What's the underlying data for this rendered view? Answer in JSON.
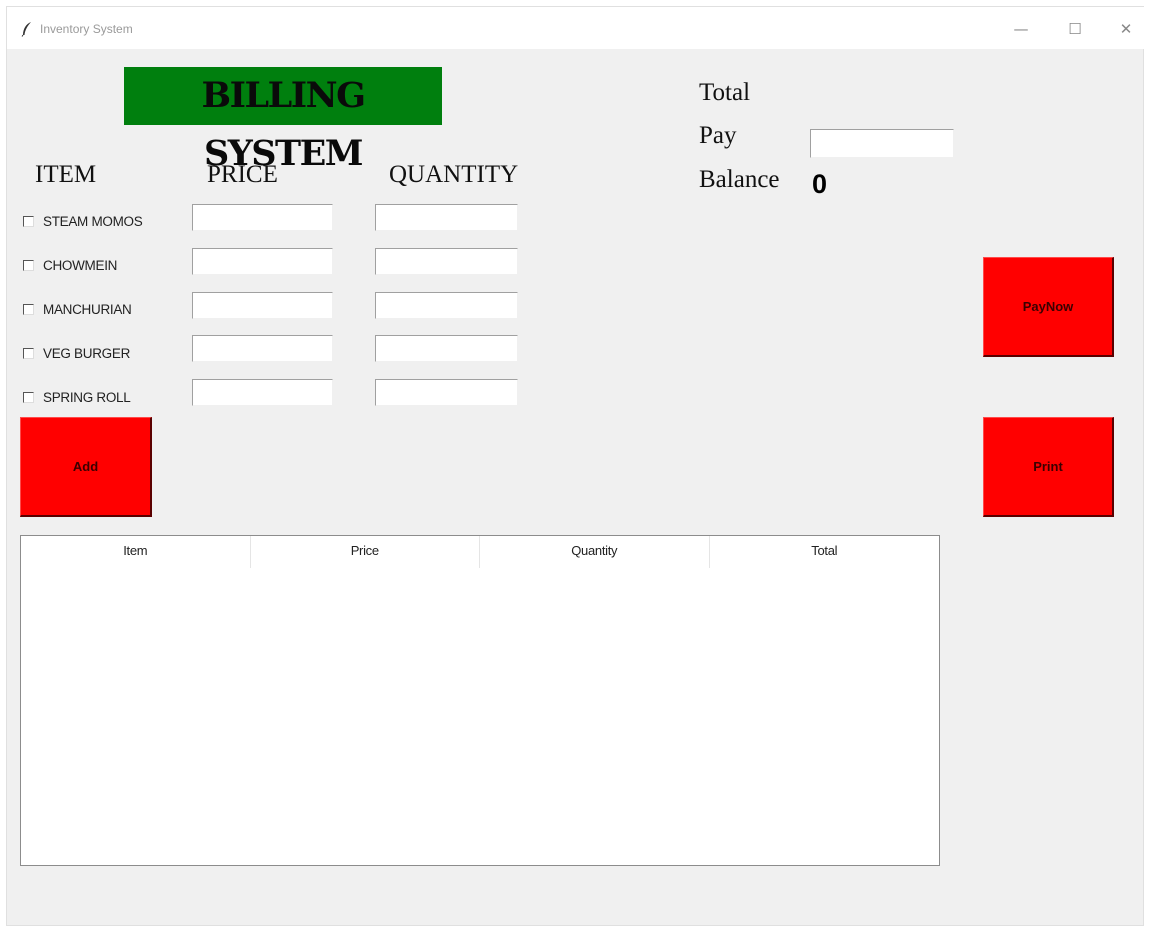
{
  "window": {
    "title": "Inventory System",
    "controls": {
      "minimize": "—",
      "maximize": "☐",
      "close": "✕"
    }
  },
  "heading": "BILLING SYSTEM",
  "columns": {
    "item": "ITEM",
    "price": "PRICE",
    "quantity": "QUANTITY"
  },
  "items": [
    {
      "label": "STEAM MOMOS",
      "checked": false,
      "price": "",
      "quantity": ""
    },
    {
      "label": "CHOWMEIN",
      "checked": false,
      "price": "",
      "quantity": ""
    },
    {
      "label": "MANCHURIAN",
      "checked": false,
      "price": "",
      "quantity": ""
    },
    {
      "label": "VEG BURGER",
      "checked": false,
      "price": "",
      "quantity": ""
    },
    {
      "label": "SPRING ROLL",
      "checked": false,
      "price": "",
      "quantity": ""
    }
  ],
  "buttons": {
    "add": "Add",
    "paynow": "PayNow",
    "print": "Print"
  },
  "summary": {
    "total_label": "Total",
    "pay_label": "Pay",
    "pay_value": "",
    "balance_label": "Balance",
    "balance_value": "0"
  },
  "table": {
    "headers": [
      "Item",
      "Price",
      "Quantity",
      "Total"
    ],
    "rows": []
  },
  "colors": {
    "heading_bg": "#007f0e",
    "button_bg": "#ff0000",
    "window_bg": "#f0f0f0"
  },
  "icons": {
    "app": "feather-icon"
  }
}
